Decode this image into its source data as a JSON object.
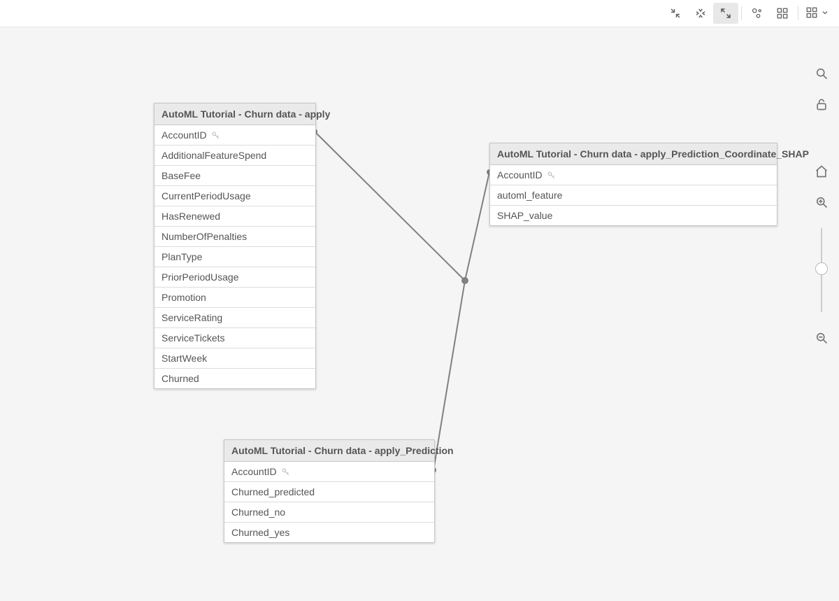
{
  "toolbar": {
    "icons": [
      "collapse-in",
      "collapse-center",
      "expand-out",
      "bubble-view",
      "grid-view",
      "layout-view"
    ],
    "active_icon": "expand-out"
  },
  "side": {
    "search": "Search",
    "lock": "Unlock layout",
    "home": "Reset zoom",
    "zoom_in": "Zoom in",
    "zoom_out": "Zoom out",
    "zoom_thumb_pct": 48
  },
  "entities": [
    {
      "id": "apply",
      "title": "AutoML Tutorial - Churn data - apply",
      "fields": [
        {
          "name": "AccountID",
          "key": true
        },
        {
          "name": "AdditionalFeatureSpend",
          "key": false
        },
        {
          "name": "BaseFee",
          "key": false
        },
        {
          "name": "CurrentPeriodUsage",
          "key": false
        },
        {
          "name": "HasRenewed",
          "key": false
        },
        {
          "name": "NumberOfPenalties",
          "key": false
        },
        {
          "name": "PlanType",
          "key": false
        },
        {
          "name": "PriorPeriodUsage",
          "key": false
        },
        {
          "name": "Promotion",
          "key": false
        },
        {
          "name": "ServiceRating",
          "key": false
        },
        {
          "name": "ServiceTickets",
          "key": false
        },
        {
          "name": "StartWeek",
          "key": false
        },
        {
          "name": "Churned",
          "key": false
        }
      ]
    },
    {
      "id": "shap",
      "title": "AutoML Tutorial - Churn data - apply_Prediction_Coordinate_SHAP",
      "fields": [
        {
          "name": "AccountID",
          "key": true
        },
        {
          "name": "automl_feature",
          "key": false
        },
        {
          "name": "SHAP_value",
          "key": false
        }
      ]
    },
    {
      "id": "pred",
      "title": "AutoML Tutorial - Churn data - apply_Prediction",
      "fields": [
        {
          "name": "AccountID",
          "key": true
        },
        {
          "name": "Churned_predicted",
          "key": false
        },
        {
          "name": "Churned_no",
          "key": false
        },
        {
          "name": "Churned_yes",
          "key": false
        }
      ]
    }
  ]
}
